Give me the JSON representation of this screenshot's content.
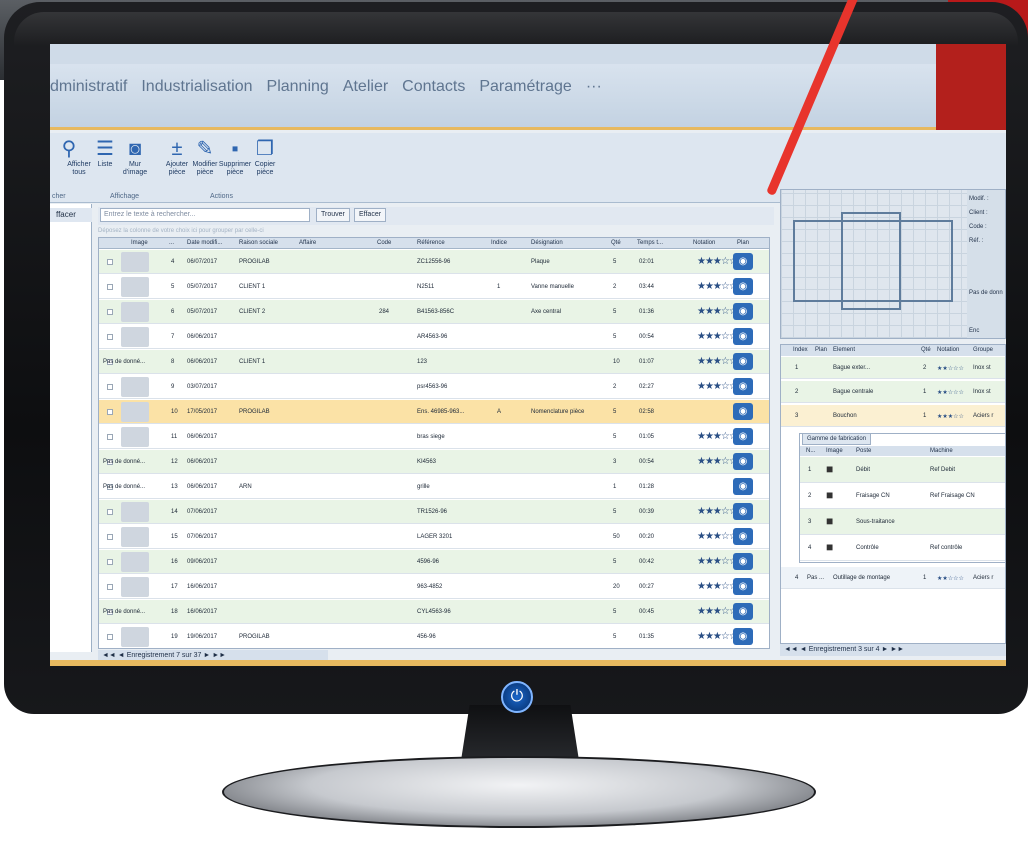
{
  "menu": {
    "items": [
      "dministratif",
      "Industrialisation",
      "Planning",
      "Atelier",
      "Contacts",
      "Paramétrage",
      "···"
    ]
  },
  "ribbon": {
    "buttons": [
      {
        "label": "",
        "icon": "search-icon"
      },
      {
        "label": "Afficher tous",
        "icon": "list-icon"
      },
      {
        "label": "Liste",
        "icon": "list-icon"
      },
      {
        "label": "Mur d'image",
        "icon": "camera-icon"
      },
      {
        "label": "Ajouter pièce",
        "icon": "plus-icon"
      },
      {
        "label": "Modifier pièce",
        "icon": "pencil-icon"
      },
      {
        "label": "Supprimer pièce",
        "icon": "trash-icon"
      },
      {
        "label": "Copier pièce",
        "icon": "copy-icon"
      }
    ],
    "groups": [
      "cher",
      "Affichage",
      "Actions"
    ]
  },
  "left_pane": {
    "tab": "ffacer"
  },
  "search": {
    "placeholder": "Entrez le texte à rechercher...",
    "find_label": "Trouver",
    "clear_label": "Effacer",
    "group_hint": "Déposez la colonne de votre choix ici pour grouper par celle-ci"
  },
  "grid": {
    "columns": [
      "Image",
      "...",
      "Date modifi...",
      "Raison sociale",
      "Affaire",
      "Code",
      "Référence",
      "Indice",
      "Désignation",
      "Qté",
      "Temps t...",
      "Notation",
      "Plan"
    ],
    "rows": [
      {
        "img": "",
        "num": "4",
        "date": "06/07/2017",
        "client": "PROGILAB",
        "code": "",
        "ref": "ZC12556-96",
        "indice": "",
        "desig": "Plaque",
        "qte": "5",
        "temps": "02:01",
        "stars": "★★★☆☆",
        "style": "green"
      },
      {
        "img": "",
        "num": "5",
        "date": "05/07/2017",
        "client": "CLIENT 1",
        "code": "",
        "ref": "N2511",
        "indice": "1",
        "desig": "Vanne manuelle",
        "qte": "2",
        "temps": "03:44",
        "stars": "★★★☆☆",
        "style": "white"
      },
      {
        "img": "",
        "num": "6",
        "date": "05/07/2017",
        "client": "CLIENT 2",
        "code": "284",
        "ref": "B41563-856C",
        "indice": "",
        "desig": "Axe central",
        "qte": "5",
        "temps": "01:36",
        "stars": "★★★☆☆",
        "style": "green"
      },
      {
        "img": "",
        "num": "7",
        "date": "06/06/2017",
        "client": "",
        "code": "",
        "ref": "AR4563-96",
        "indice": "",
        "desig": "",
        "qte": "5",
        "temps": "00:54",
        "stars": "★★★☆☆",
        "style": "white"
      },
      {
        "img": "Pas de donné...",
        "num": "8",
        "date": "06/06/2017",
        "client": "CLIENT 1",
        "code": "",
        "ref": "123",
        "indice": "",
        "desig": "",
        "qte": "10",
        "temps": "01:07",
        "stars": "★★★☆☆",
        "style": "green"
      },
      {
        "img": "",
        "num": "9",
        "date": "03/07/2017",
        "client": "",
        "code": "",
        "ref": "psr4563-96",
        "indice": "",
        "desig": "",
        "qte": "2",
        "temps": "02:27",
        "stars": "★★★☆☆",
        "style": "white"
      },
      {
        "img": "",
        "num": "10",
        "date": "17/05/2017",
        "client": "PROGILAB",
        "code": "",
        "ref": "Ens. 46985-963...",
        "indice": "A",
        "desig": "Nomenclature pièce",
        "qte": "5",
        "temps": "02:58",
        "stars": "",
        "style": "selected"
      },
      {
        "img": "",
        "num": "11",
        "date": "06/06/2017",
        "client": "",
        "code": "",
        "ref": "bras siege",
        "indice": "",
        "desig": "",
        "qte": "5",
        "temps": "01:05",
        "stars": "★★★☆☆",
        "style": "white"
      },
      {
        "img": "Pas de donné...",
        "num": "12",
        "date": "06/06/2017",
        "client": "",
        "code": "",
        "ref": "KI4563",
        "indice": "",
        "desig": "",
        "qte": "3",
        "temps": "00:54",
        "stars": "★★★☆☆",
        "style": "green"
      },
      {
        "img": "Pas de donné...",
        "num": "13",
        "date": "06/06/2017",
        "client": "ARN",
        "code": "",
        "ref": "grille",
        "indice": "",
        "desig": "",
        "qte": "1",
        "temps": "01:28",
        "stars": "",
        "style": "white"
      },
      {
        "img": "",
        "num": "14",
        "date": "07/06/2017",
        "client": "",
        "code": "",
        "ref": "TR1526-96",
        "indice": "",
        "desig": "",
        "qte": "5",
        "temps": "00:39",
        "stars": "★★★☆☆",
        "style": "green"
      },
      {
        "img": "",
        "num": "15",
        "date": "07/06/2017",
        "client": "",
        "code": "",
        "ref": "LAGER 3201",
        "indice": "",
        "desig": "",
        "qte": "50",
        "temps": "00:20",
        "stars": "★★★☆☆",
        "style": "white"
      },
      {
        "img": "",
        "num": "16",
        "date": "09/06/2017",
        "client": "",
        "code": "",
        "ref": "4596-96",
        "indice": "",
        "desig": "",
        "qte": "5",
        "temps": "00:42",
        "stars": "★★★☆☆",
        "style": "green"
      },
      {
        "img": "",
        "num": "17",
        "date": "16/06/2017",
        "client": "",
        "code": "",
        "ref": "963-4852",
        "indice": "",
        "desig": "",
        "qte": "20",
        "temps": "00:27",
        "stars": "★★★☆☆",
        "style": "white"
      },
      {
        "img": "Pas de donné...",
        "num": "18",
        "date": "16/06/2017",
        "client": "",
        "code": "",
        "ref": "CYL4563-96",
        "indice": "",
        "desig": "",
        "qte": "5",
        "temps": "00:45",
        "stars": "★★★☆☆",
        "style": "green"
      },
      {
        "img": "",
        "num": "19",
        "date": "19/06/2017",
        "client": "PROGILAB",
        "code": "",
        "ref": "456-96",
        "indice": "",
        "desig": "",
        "qte": "5",
        "temps": "01:35",
        "stars": "★★★☆☆",
        "style": "white"
      }
    ],
    "pager": "Enregistrement 7 sur 37"
  },
  "preview": {
    "meta": [
      "Modif. :",
      "Client :",
      "Code :",
      "Réf. :",
      "Pas de donn",
      "Enc"
    ]
  },
  "rgrid": {
    "columns": [
      "Index",
      "Plan",
      "Element",
      "Qté",
      "Notation",
      "Groupe"
    ],
    "rows": [
      {
        "idx": "1",
        "element": "Bague exter...",
        "qte": "2",
        "stars": "★★☆☆☆",
        "group": "Inox st"
      },
      {
        "idx": "2",
        "element": "Bague centrale",
        "qte": "1",
        "stars": "★★☆☆☆",
        "group": "Inox st"
      },
      {
        "idx": "3",
        "element": "Bouchon",
        "qte": "1",
        "stars": "★★★☆☆",
        "group": "Aciers r"
      }
    ],
    "last_row": {
      "idx": "4",
      "plan": "Pas ...",
      "element": "Outillage de montage",
      "qte": "1",
      "stars": "★★☆☆☆",
      "group": "Aciers r"
    },
    "sub_tab": "Gamme de fabrication",
    "sub_columns": [
      "N...",
      "Image",
      "Poste",
      "Machine"
    ],
    "sub_rows": [
      {
        "n": "1",
        "poste": "Débit",
        "machine": "Ref Debit",
        "icon": "saw-icon"
      },
      {
        "n": "2",
        "poste": "Fraisage CN",
        "machine": "Ref Fraisage CN",
        "icon": "mill-icon"
      },
      {
        "n": "3",
        "poste": "Sous-traitance",
        "machine": "",
        "icon": "person-icon"
      },
      {
        "n": "4",
        "poste": "Contrôle",
        "machine": "Ref contrôle",
        "icon": "caliper-icon"
      }
    ],
    "pager": "Enregistrement 3 sur 4"
  },
  "colors": {
    "accent": "#2d6bb8",
    "highlight": "#fbe2a6",
    "brand_red": "#b3201c"
  }
}
